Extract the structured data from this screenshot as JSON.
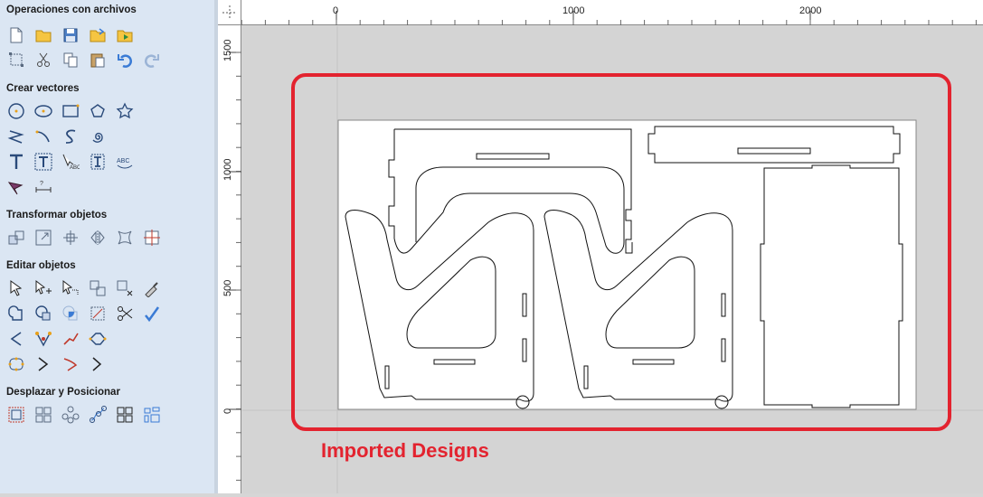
{
  "panel": {
    "sections": {
      "file_ops": "Operaciones con archivos",
      "create_vectors": "Crear vectores",
      "transform": "Transformar objetos",
      "edit": "Editar objetos",
      "position": "Desplazar y Posicionar"
    }
  },
  "ruler": {
    "top_labels": [
      "0",
      "1000",
      "2000"
    ],
    "left_labels": [
      "1500",
      "1000",
      "500",
      "0"
    ]
  },
  "canvas": {
    "annotation": "Imported Designs",
    "annotation_color": "#e3232f"
  }
}
